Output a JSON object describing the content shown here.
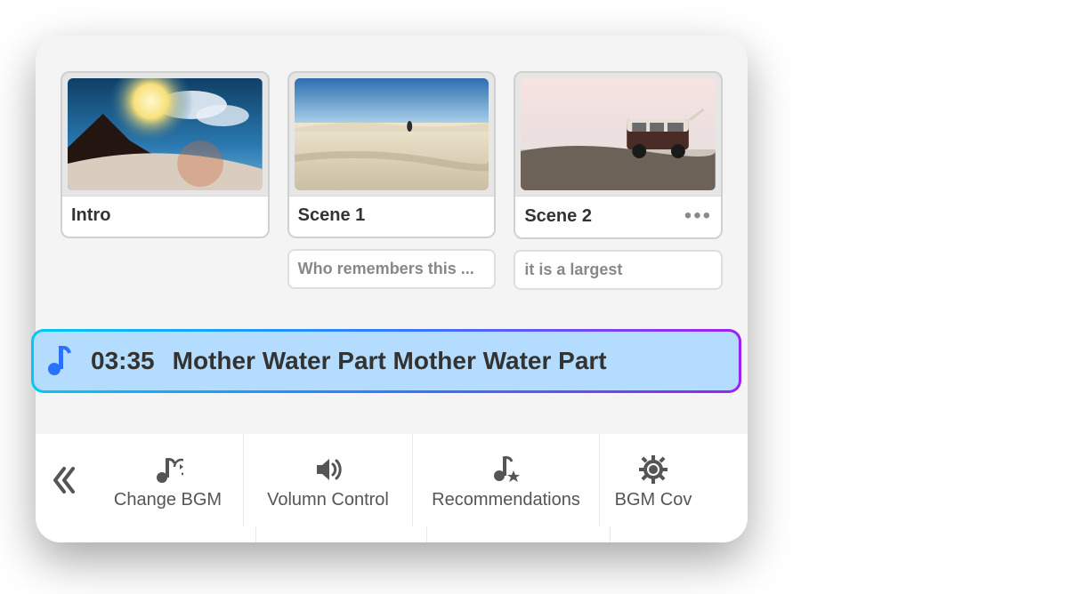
{
  "scenes": [
    {
      "title": "Intro",
      "caption": null
    },
    {
      "title": "Scene 1",
      "caption": "Who remembers this ..."
    },
    {
      "title": "Scene 2",
      "caption": "it is a largest",
      "more": true
    }
  ],
  "bgm": {
    "time": "03:35",
    "title": "Mother Water Part Mother Water Part"
  },
  "toolbar": {
    "items": [
      {
        "label": "Change BGM"
      },
      {
        "label": "Volumn Control"
      },
      {
        "label": "Recommendations"
      },
      {
        "label": "BGM Cov"
      }
    ]
  }
}
